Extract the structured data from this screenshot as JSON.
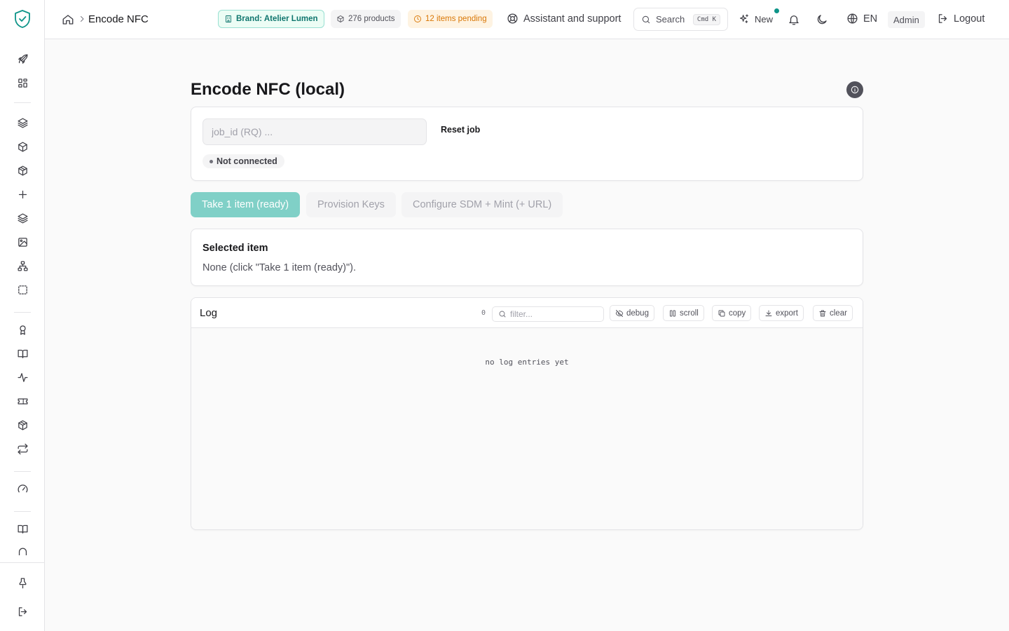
{
  "header": {
    "breadcrumb_title": "Encode NFC",
    "brand_chip": "Brand: Atelier Lumen",
    "products_chip": "276 products",
    "pending_chip": "12 items pending",
    "assistant_label": "Assistant and support",
    "search_label": "Search",
    "search_kbd": "Cmd K",
    "new_label": "New",
    "language_label": "EN",
    "role_badge": "Admin",
    "logout_label": "Logout"
  },
  "main": {
    "title": "Encode NFC (local)",
    "job_input_placeholder": "job_id (RQ) ...",
    "job_input_value": "",
    "reset_job_label": "Reset job",
    "connection_status": "Not connected",
    "steps": [
      {
        "label": "Take 1 item (ready)"
      },
      {
        "label": "Provision Keys"
      },
      {
        "label": "Configure SDM + Mint (+ URL)"
      }
    ],
    "selected": {
      "title": "Selected item",
      "value": "None (click \"Take 1 item (ready)\")."
    },
    "log": {
      "title": "Log",
      "count": "0",
      "filter_placeholder": "filter...",
      "buttons": {
        "debug": "debug",
        "scroll": "scroll",
        "copy": "copy",
        "export": "export",
        "clear": "clear"
      },
      "empty_text": "no log entries yet"
    }
  },
  "sidebar": {
    "icons": [
      "rocket-icon",
      "dashboard-icon",
      "layers-icon",
      "box-icon",
      "package-icon",
      "plus-icon",
      "layers-icon",
      "image-icon",
      "sitemap-icon",
      "dashed-square-icon",
      "award-icon",
      "book-icon",
      "activity-icon",
      "ticket-icon",
      "package-icon",
      "repeat-icon",
      "gauge-icon",
      "book-icon",
      "arch-icon",
      "pin-icon",
      "logout-icon"
    ]
  },
  "colors": {
    "accent": "#0d9488",
    "brand_chip_bg": "#ecfdf5",
    "pending_chip_bg": "#fef3e2",
    "pending_text": "#d97706",
    "primary_step_bg": "#80d0c7"
  }
}
